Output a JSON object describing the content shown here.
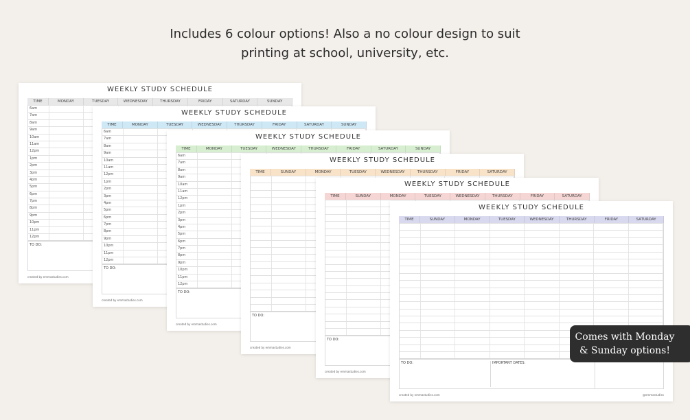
{
  "headline": {
    "line1": "Includes 6 colour options! Also a no colour design to suit",
    "line2": "printing at school, university, etc."
  },
  "sheet_title": "WEEKLY STUDY SCHEDULE",
  "todo_label": "TO DO:",
  "important_label": "IMPORTANT DATES:",
  "credit": "created by emmastudies.com",
  "handle": "@emmastudies",
  "callout": {
    "line1": "Comes with Monday",
    "line2": "& Sunday options!"
  },
  "time_header": "TIME",
  "days_monday_first": [
    "MONDAY",
    "TUESDAY",
    "WEDNESDAY",
    "THURSDAY",
    "FRIDAY",
    "SATURDAY",
    "SUNDAY"
  ],
  "days_sunday_first": [
    "SUNDAY",
    "MONDAY",
    "TUESDAY",
    "WEDNESDAY",
    "THURSDAY",
    "FRIDAY",
    "SATURDAY"
  ],
  "times": [
    "6am",
    "7am",
    "8am",
    "9am",
    "10am",
    "11am",
    "12pm",
    "1pm",
    "2pm",
    "3pm",
    "4pm",
    "5pm",
    "6pm",
    "7pm",
    "8pm",
    "9pm",
    "10pm",
    "11pm",
    "12pm"
  ],
  "sheet_colors": [
    "#e8e8e8",
    "#cfe8f6",
    "#d7efd0",
    "#f8e2c8",
    "#f5d6d4",
    "#d8d8ef"
  ]
}
